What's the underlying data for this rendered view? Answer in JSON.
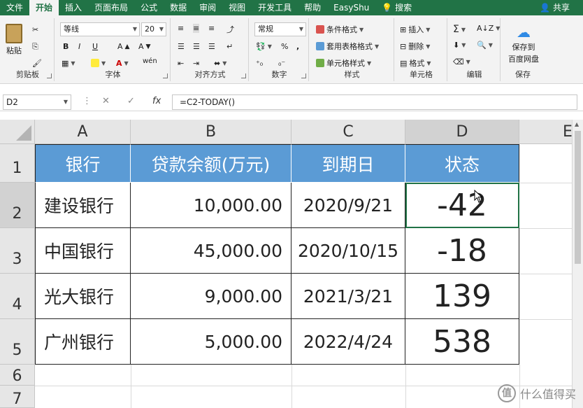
{
  "ribbon_tabs": [
    "文件",
    "开始",
    "插入",
    "页面布局",
    "公式",
    "数据",
    "审阅",
    "视图",
    "开发工具",
    "帮助",
    "EasyShu",
    "搜索"
  ],
  "share_label": "共享",
  "clipboard": {
    "paste": "粘贴",
    "label": "剪贴板"
  },
  "font": {
    "name": "等线",
    "size": "20",
    "label": "字体",
    "bold": "B",
    "italic": "I",
    "underline": "U",
    "wen": "wén"
  },
  "align": {
    "label": "对齐方式"
  },
  "number": {
    "format": "常规",
    "label": "数字",
    "percent": "%",
    "comma": ","
  },
  "styles": {
    "cond": "条件格式",
    "table": "套用表格格式",
    "cell": "单元格样式",
    "label": "样式"
  },
  "cells": {
    "insert": "插入",
    "delete": "删除",
    "format": "格式",
    "label": "单元格"
  },
  "edit": {
    "label": "编辑"
  },
  "save": {
    "line1": "保存到",
    "line2": "百度网盘",
    "label": "保存"
  },
  "formula_bar": {
    "name_box": "D2",
    "formula": "=C2-TODAY()",
    "fx": "fx"
  },
  "columns": [
    "A",
    "B",
    "C",
    "D",
    "E"
  ],
  "rows": [
    "1",
    "2",
    "3",
    "4",
    "5",
    "6",
    "7"
  ],
  "table": {
    "headers": [
      "银行",
      "贷款余额(万元)",
      "到期日",
      "状态"
    ],
    "rows": [
      [
        "建设银行",
        "10,000.00",
        "2020/9/21",
        "-42"
      ],
      [
        "中国银行",
        "45,000.00",
        "2020/10/15",
        "-18"
      ],
      [
        "光大银行",
        "9,000.00",
        "2021/3/21",
        "139"
      ],
      [
        "广州银行",
        "5,000.00",
        "2022/4/24",
        "538"
      ]
    ]
  },
  "watermark": {
    "icon": "值",
    "text": "什么值得买"
  },
  "colors": {
    "excel_green": "#217346",
    "header_fill": "#5b9bd5"
  }
}
